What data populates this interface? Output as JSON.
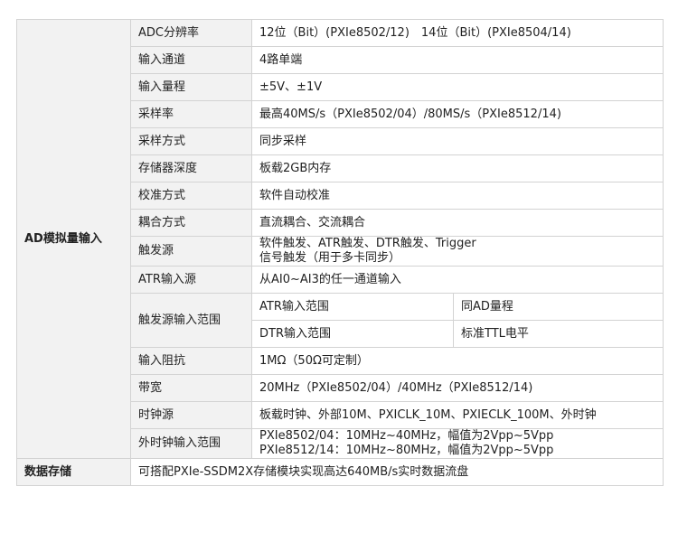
{
  "table": {
    "category_ad": "AD模拟量输入",
    "category_storage": "数据存储",
    "rows": [
      {
        "label": "ADC分辨率",
        "value": "12位（Bit）(PXIe8502/12)　14位（Bit）(PXIe8504/14)"
      },
      {
        "label": "输入通道",
        "value": "4路单端"
      },
      {
        "label": "输入量程",
        "value": "±5V、±1V"
      },
      {
        "label": "采样率",
        "value": "最高40MS/s（PXIe8502/04）/80MS/s（PXIe8512/14)"
      },
      {
        "label": "采样方式",
        "value": "同步采样"
      },
      {
        "label": "存储器深度",
        "value": "板载2GB内存"
      },
      {
        "label": "校准方式",
        "value": "软件自动校准"
      },
      {
        "label": "耦合方式",
        "value": "直流耦合、交流耦合"
      },
      {
        "label": "触发源",
        "value_lines": [
          "软件触发、ATR触发、DTR触发、Trigger",
          "信号触发（用于多卡同步）"
        ]
      },
      {
        "label": "ATR输入源",
        "value": "从AI0~AI3的任一通道输入"
      },
      {
        "label": "触发源输入范围",
        "sub": [
          {
            "name": "ATR输入范围",
            "value": "同AD量程"
          },
          {
            "name": "DTR输入范围",
            "value": "标准TTL电平"
          }
        ]
      },
      {
        "label": "输入阻抗",
        "value": "1MΩ（50Ω可定制）"
      },
      {
        "label": "带宽",
        "value": "20MHz（PXIe8502/04）/40MHz（PXIe8512/14)"
      },
      {
        "label": "时钟源",
        "value": "板载时钟、外部10M、PXICLK_10M、PXIECLK_100M、外时钟"
      },
      {
        "label": "外时钟输入范围",
        "value_lines": [
          "PXIe8502/04：10MHz~40MHz，幅值为2Vpp~5Vpp",
          "PXIe8512/14：10MHz~80MHz，幅值为2Vpp~5Vpp"
        ]
      }
    ],
    "storage_value": "可搭配PXIe-SSDM2X存储模块实现高达640MB/s实时数据流盘"
  }
}
